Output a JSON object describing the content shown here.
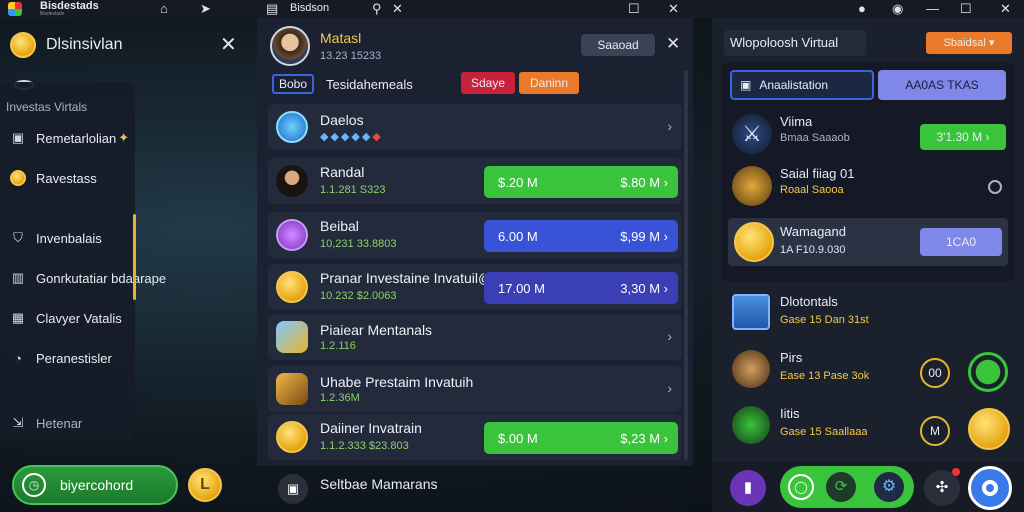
{
  "topbar": {
    "app_title": "Bisdestads",
    "app_subtitle": "Bisdestads",
    "center_title": "Bisdson"
  },
  "left": {
    "title": "Dlsinsivlan",
    "section_label": "Investas Virtals",
    "nav": [
      {
        "label": "Remetarlolian",
        "icon": "wallet-icon"
      },
      {
        "label": "Ravestass",
        "icon": "coin-icon"
      },
      {
        "label": "Invenbalais",
        "icon": "shield-icon"
      },
      {
        "label": "Gonrkutatiar bdaarape",
        "icon": "building-icon"
      },
      {
        "label": "Clavyer Vatalis",
        "icon": "calendar-icon"
      },
      {
        "label": "Peranestisler",
        "icon": "settings-icon"
      },
      {
        "label": "Hetenar",
        "icon": "exit-icon"
      }
    ],
    "cta_label": "biyercohord"
  },
  "center": {
    "profile": {
      "name": "Matasl",
      "meta": "13.23 15233"
    },
    "search_button": "Saaoad",
    "tag": "Bobo",
    "filter_title": "Tesidahemeals",
    "btn_red": "Sdaye",
    "btn_orange": "Daninn",
    "rows": [
      {
        "name": "Daelos",
        "sub": "",
        "icon": "shield-icon",
        "type": "chevron"
      },
      {
        "name": "Randal",
        "sub": "1.1.281 S323",
        "left": "$.20 M",
        "right": "$.80 M",
        "color": "green"
      },
      {
        "name": "Beibal",
        "sub": "10,231 33.8803",
        "left": "6.00 M",
        "right": "$,99 M",
        "color": "blue"
      },
      {
        "name": "Pranar Investaine Invatuil@",
        "sub": "10.232 $2.0063",
        "left": "17.00 M",
        "right": "3,30 M",
        "color": "indigo"
      },
      {
        "name": "Piaiear Mentanals",
        "sub": "1.2.116",
        "icon": "gem-icon",
        "type": "chevron"
      },
      {
        "name": "Uhabe Prestaim Invatuih",
        "sub": "1.2.36M",
        "icon": "gem-icon",
        "type": "chevron"
      },
      {
        "name": "Daiiner Invatrain",
        "sub": "1.1.2.333 $23.803",
        "left": "$.00 M",
        "right": "$,23 M",
        "color": "green"
      },
      {
        "name": "Seltbae Mamarans",
        "sub": "",
        "icon": "wallet-icon",
        "type": "partial"
      }
    ]
  },
  "right": {
    "title": "Wlopoloosh Virtual",
    "dropdown": "Sbaidsal",
    "tab1": "Anaalistation",
    "tab2": "AA0AS TKAS",
    "items": [
      {
        "name": "Viima",
        "sub": "Bmaa Saaaob",
        "value": "3'1.30 M",
        "kind": "green"
      },
      {
        "name": "Saial fiiag 01",
        "sub": "Roaal Saooa",
        "value": "",
        "kind": "radio"
      },
      {
        "name": "Wamagand",
        "sub": "1A F10.9.030",
        "value": "1CA0",
        "kind": "blue"
      }
    ],
    "lower": [
      {
        "name": "Dlotontals",
        "sub": "Gase 15 Dan 31st"
      },
      {
        "name": "Pirs",
        "sub": "Ease 13 Pase 3ok"
      },
      {
        "name": "Iitis",
        "sub": "Gase 15 Saallaaa"
      }
    ],
    "lower_btn_1": "00",
    "lower_btn_2": "M"
  },
  "colors": {
    "green": "#39c43b",
    "blue": "#3a52d6",
    "indigo": "#3b3fb5",
    "orange": "#ea7a2a",
    "red": "#c8223a"
  }
}
